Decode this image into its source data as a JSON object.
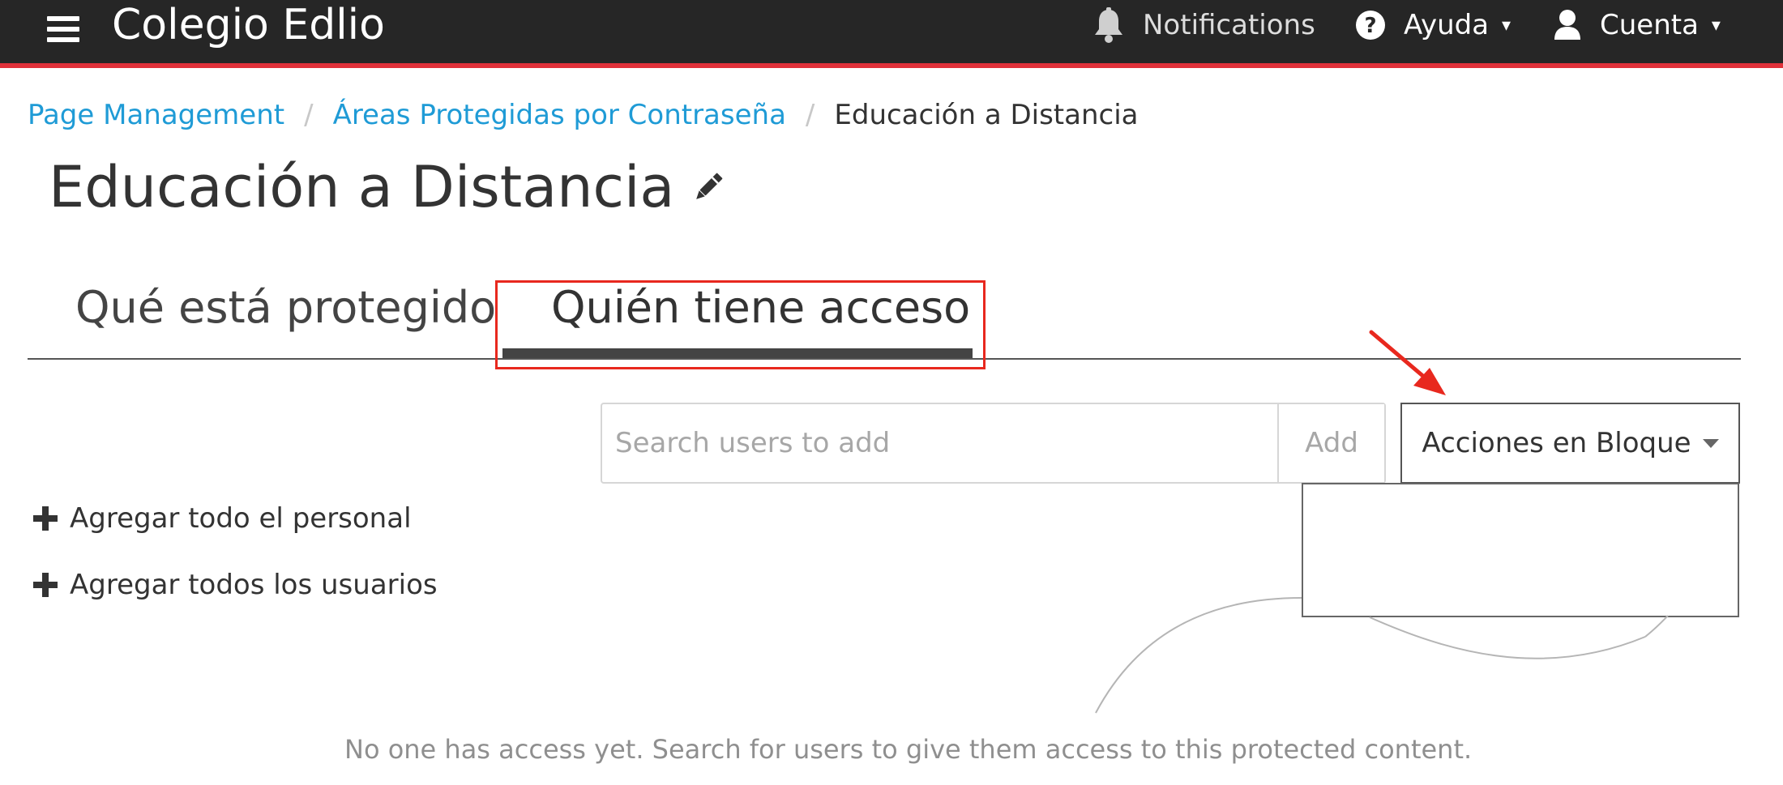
{
  "app": {
    "title": "Colegio Edlio"
  },
  "topbar": {
    "notifications_label": "Notifications",
    "help_label": "Ayuda",
    "account_label": "Cuenta",
    "caret": "▾",
    "icons": [
      "menu-icon",
      "bell-icon",
      "question-circle-icon",
      "user-icon"
    ]
  },
  "breadcrumb": {
    "items": [
      "Page Management",
      "Áreas Protegidas por Contraseña",
      "Educación a Distancia"
    ],
    "separator": "/"
  },
  "page": {
    "title": "Educación a Distancia",
    "edit_icon": "pencil-icon"
  },
  "tabs": [
    {
      "label": "Qué está protegido",
      "active": false
    },
    {
      "label": "Quién tiene acceso",
      "active": true
    }
  ],
  "search": {
    "placeholder": "Search users to add",
    "value": "",
    "add_label": "Add"
  },
  "bulk_actions": {
    "label": "Acciones en Bloque",
    "items": [
      {
        "label": "Agregar todo el personal",
        "icon": "plus-icon"
      },
      {
        "label": "Agregar todos los usuarios",
        "icon": "plus-icon"
      }
    ]
  },
  "empty_state": {
    "message": "No one has access yet. Search for users to give them access to this protected content."
  },
  "colors": {
    "topbar": "#262626",
    "accent_red": "#e0313a",
    "link": "#1f9bd6",
    "annotation": "#e8281e",
    "muted_text": "#8f8f8f"
  }
}
